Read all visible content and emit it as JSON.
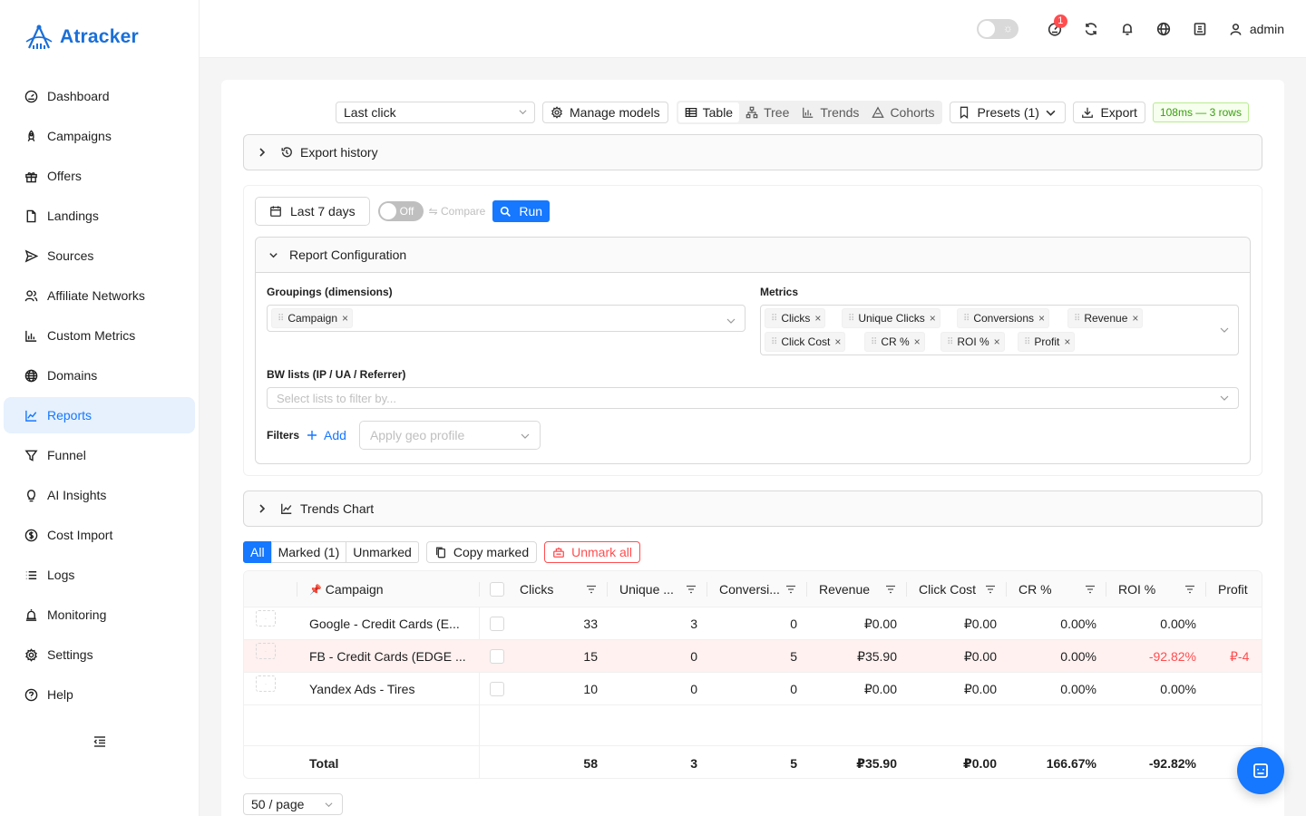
{
  "app": {
    "name": "Atracker",
    "brand_color": "#1a6fd8",
    "accent_color": "#1677ff"
  },
  "sidebar": {
    "items": [
      {
        "label": "Dashboard",
        "icon": "dashboard-icon"
      },
      {
        "label": "Campaigns",
        "icon": "rocket-icon"
      },
      {
        "label": "Offers",
        "icon": "gift-icon"
      },
      {
        "label": "Landings",
        "icon": "file-icon"
      },
      {
        "label": "Sources",
        "icon": "send-icon"
      },
      {
        "label": "Affiliate Networks",
        "icon": "users-icon"
      },
      {
        "label": "Custom Metrics",
        "icon": "bar-chart-icon"
      },
      {
        "label": "Domains",
        "icon": "globe-icon"
      },
      {
        "label": "Reports",
        "icon": "line-chart-icon",
        "active": true
      },
      {
        "label": "Funnel",
        "icon": "funnel-icon"
      },
      {
        "label": "AI Insights",
        "icon": "bulb-icon"
      },
      {
        "label": "Cost Import",
        "icon": "dollar-icon"
      },
      {
        "label": "Logs",
        "icon": "list-icon"
      },
      {
        "label": "Monitoring",
        "icon": "alarm-icon"
      },
      {
        "label": "Settings",
        "icon": "gear-icon"
      },
      {
        "label": "Help",
        "icon": "question-icon"
      }
    ]
  },
  "header": {
    "notification_badge": "1",
    "user": "admin"
  },
  "toolbar": {
    "attribution": "Last click",
    "manage_models": "Manage models",
    "views": [
      "Table",
      "Tree",
      "Trends",
      "Cohorts"
    ],
    "active_view": "Table",
    "presets": "Presets (1)",
    "export": "Export",
    "timing": "108ms — 3 rows"
  },
  "export_history": {
    "label": "Export history"
  },
  "run": {
    "date_range": "Last 7 days",
    "compare_toggle": "Off",
    "compare_label": "⇋ Compare",
    "run_label": "Run"
  },
  "config": {
    "title": "Report Configuration",
    "groupings_label": "Groupings (dimensions)",
    "groupings": [
      "Campaign"
    ],
    "metrics_label": "Metrics",
    "metrics": [
      "Clicks",
      "Unique Clicks",
      "Conversions",
      "Revenue",
      "Click Cost",
      "CR %",
      "ROI %",
      "Profit"
    ],
    "bw_label": "BW lists (IP / UA / Referrer)",
    "bw_placeholder": "Select lists to filter by...",
    "filters_label": "Filters",
    "add_label": "Add",
    "geo_placeholder": "Apply geo profile"
  },
  "trends": {
    "label": "Trends Chart"
  },
  "marking": {
    "tabs": [
      "All",
      "Marked (1)",
      "Unmarked"
    ],
    "active": "All",
    "copy_marked": "Copy marked",
    "unmark_all": "Unmark all"
  },
  "table": {
    "columns": [
      "Campaign",
      "Clicks",
      "Unique ...",
      "Conversi...",
      "Revenue",
      "Click Cost",
      "CR %",
      "ROI %",
      "Profit"
    ],
    "rows": [
      {
        "campaign": "Google - Credit Cards (E...",
        "clicks": "33",
        "unique": "3",
        "conv": "0",
        "revenue": "₽0.00",
        "cost": "₽0.00",
        "cr": "0.00%",
        "roi": "0.00%",
        "profit": "",
        "highlight": false
      },
      {
        "campaign": "FB - Credit Cards (EDGE ...",
        "clicks": "15",
        "unique": "0",
        "conv": "5",
        "revenue": "₽35.90",
        "cost": "₽0.00",
        "cr": "0.00%",
        "roi": "-92.82%",
        "profit": "₽-4",
        "highlight": true
      },
      {
        "campaign": "Yandex Ads - Tires",
        "clicks": "10",
        "unique": "0",
        "conv": "0",
        "revenue": "₽0.00",
        "cost": "₽0.00",
        "cr": "0.00%",
        "roi": "0.00%",
        "profit": "",
        "highlight": false
      }
    ],
    "total": {
      "label": "Total",
      "clicks": "58",
      "unique": "3",
      "conv": "5",
      "revenue": "₽35.90",
      "cost": "₽0.00",
      "cr": "166.67%",
      "roi": "-92.82%",
      "profit": "₽"
    }
  },
  "pagination": {
    "page_size": "50 / page"
  }
}
